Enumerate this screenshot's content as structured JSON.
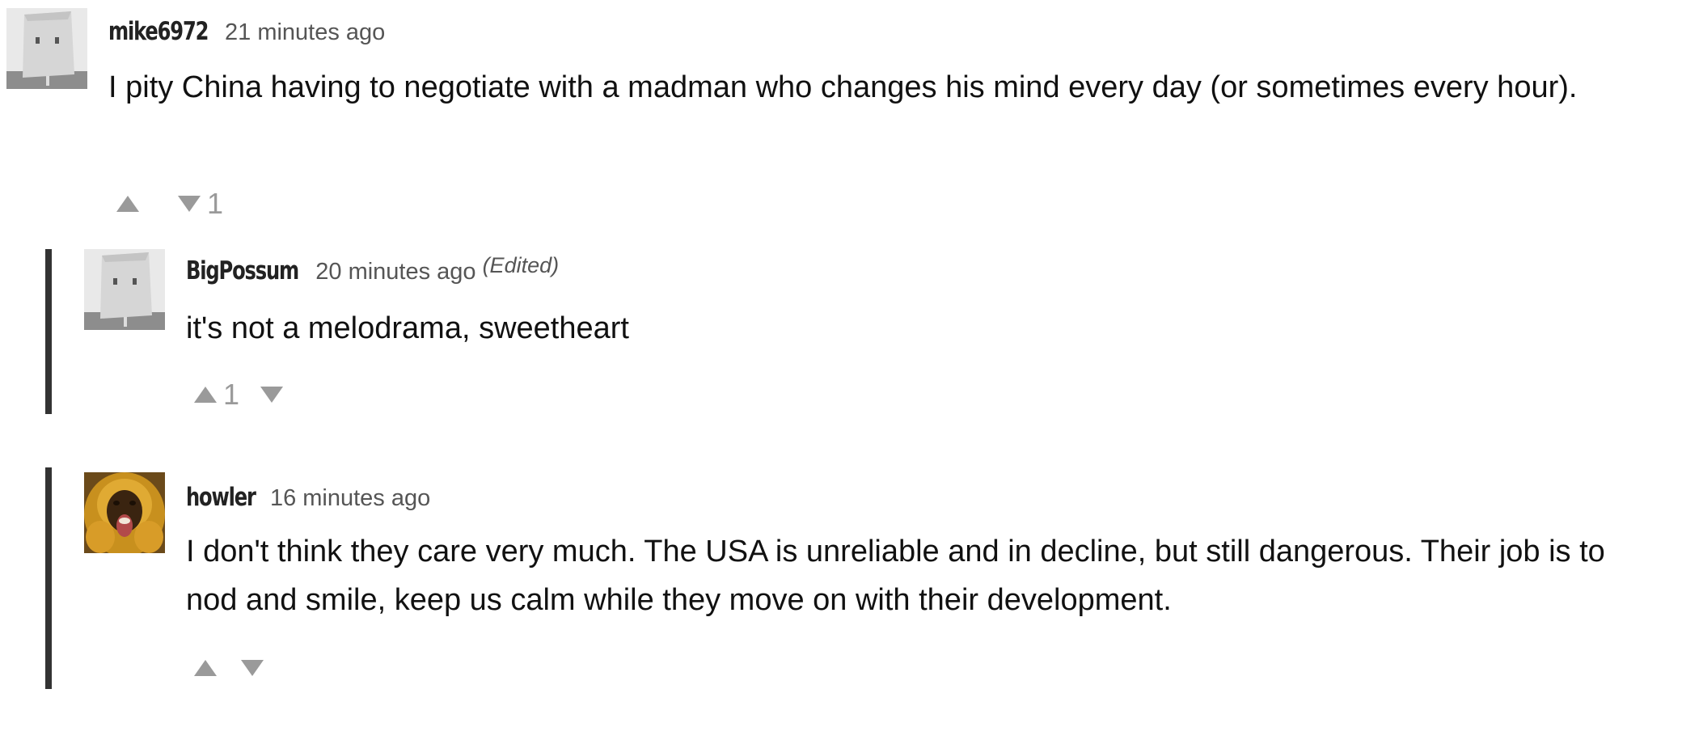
{
  "comments": [
    {
      "author": "mike6972",
      "timestamp": "21 minutes ago",
      "text": "I pity China having to negotiate with a madman who changes his mind every day (or sometimes every hour).",
      "upvotes": "",
      "downvotes": "1",
      "avatar": "paper-bag-avatar"
    },
    {
      "author": "BigPossum",
      "timestamp": "20 minutes ago",
      "edited": "(Edited)",
      "text": "it's not a melodrama, sweetheart",
      "upvotes": "1",
      "downvotes": "",
      "avatar": "paper-bag-avatar"
    },
    {
      "author": "howler",
      "timestamp": "16 minutes ago",
      "text": "I don't think they care very much. The USA is unreliable and in decline, but still dangerous. Their job is to nod and smile, keep us calm while they move on with their development.",
      "upvotes": "",
      "downvotes": "",
      "avatar": "howler-monkey-avatar"
    }
  ],
  "colors": {
    "thread_bar": "#333333",
    "vote_arrow": "#9a9a9a",
    "author": "#222222",
    "timestamp": "#555555"
  }
}
